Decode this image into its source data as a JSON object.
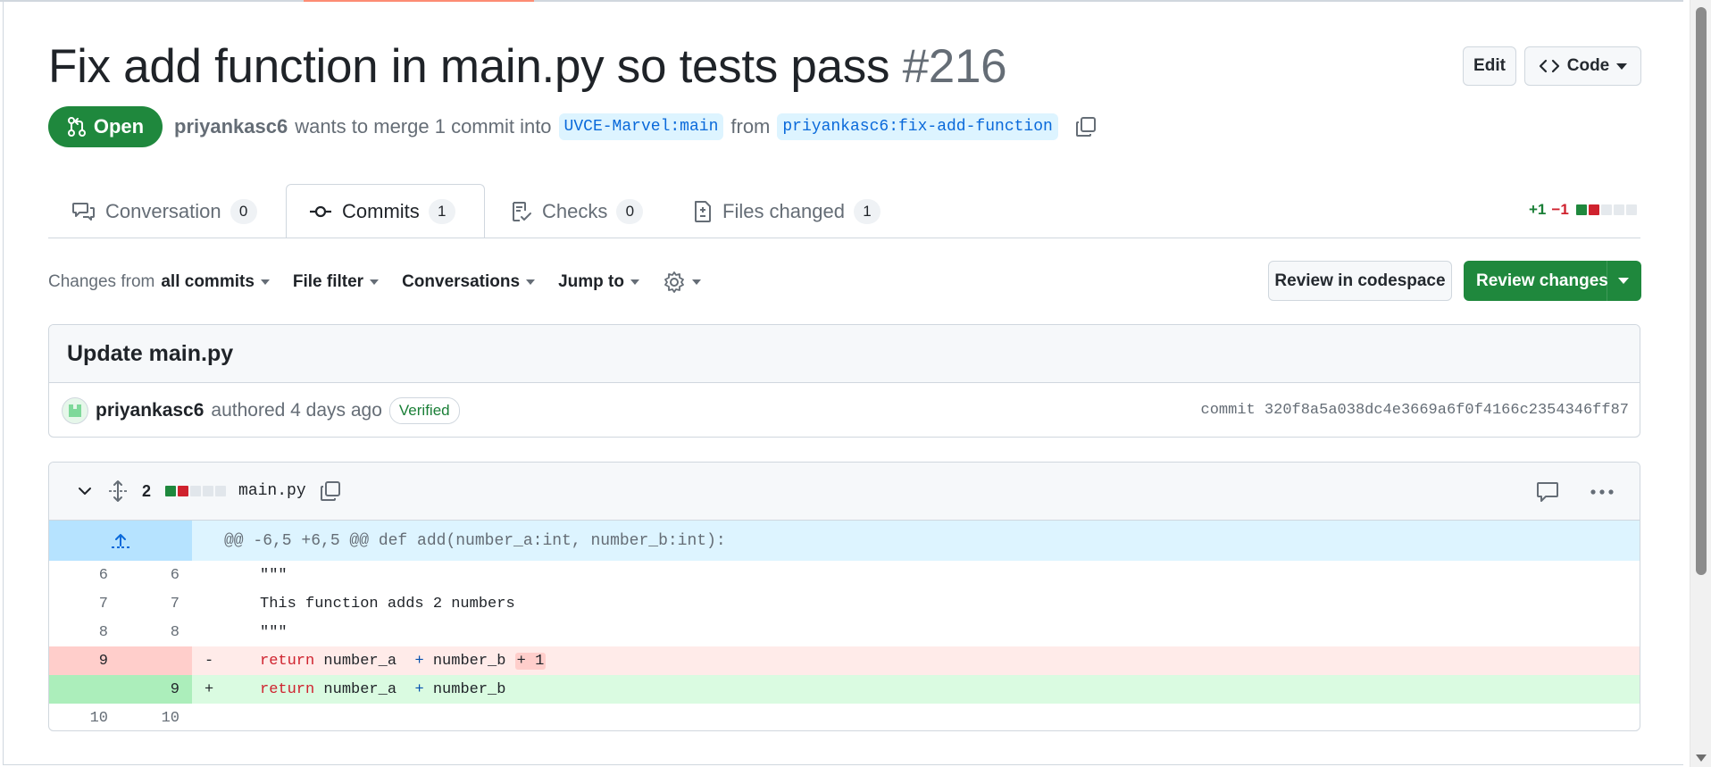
{
  "pr": {
    "title": "Fix add function in main.py so tests pass",
    "number": "#216",
    "state": "Open",
    "author": "priyankasc6",
    "merge_text": "wants to merge 1 commit into",
    "base_branch": "UVCE-Marvel:main",
    "from_text": "from",
    "head_branch": "priyankasc6:fix-add-function"
  },
  "header_buttons": {
    "edit": "Edit",
    "code": "Code"
  },
  "tabs": [
    {
      "label": "Conversation",
      "count": "0"
    },
    {
      "label": "Commits",
      "count": "1"
    },
    {
      "label": "Checks",
      "count": "0"
    },
    {
      "label": "Files changed",
      "count": "1"
    }
  ],
  "diffstat": {
    "additions": "+1",
    "deletions": "−1"
  },
  "toolbar": {
    "changes_prefix": "Changes from",
    "changes_value": "all commits",
    "file_filter": "File filter",
    "conversations": "Conversations",
    "jump_to": "Jump to"
  },
  "actions": {
    "codespace": "Review in codespace",
    "review": "Review changes"
  },
  "commit": {
    "message": "Update main.py",
    "author": "priyankasc6",
    "authored": "authored 4 days ago",
    "verified": "Verified",
    "sha_label": "commit 320f8a5a038dc4e3669a6f0f4166c2354346ff87"
  },
  "file": {
    "changes": "2",
    "name": "main.py",
    "hunk": "@@ -6,5 +6,5 @@ def add(number_a:int, number_b:int):",
    "lines": [
      {
        "old": "6",
        "new": "6",
        "sign": "",
        "text": "\"\"\""
      },
      {
        "old": "7",
        "new": "7",
        "sign": "",
        "text": "This function adds 2 numbers"
      },
      {
        "old": "8",
        "new": "8",
        "sign": "",
        "text": "\"\"\""
      },
      {
        "old": "9",
        "new": "",
        "sign": "-",
        "kw": "return",
        "a": " number_a  ",
        "op": "+",
        "b": " number_b ",
        "extra": "+ 1"
      },
      {
        "old": "",
        "new": "9",
        "sign": "+",
        "kw": "return",
        "a": " number_a  ",
        "op": "+",
        "b": " number_b",
        "extra": ""
      },
      {
        "old": "10",
        "new": "10",
        "sign": "",
        "text": ""
      }
    ]
  },
  "colors": {
    "accent_green": "#1f883d",
    "link_blue": "#0969da",
    "tab_underline": "#fd8c73"
  }
}
